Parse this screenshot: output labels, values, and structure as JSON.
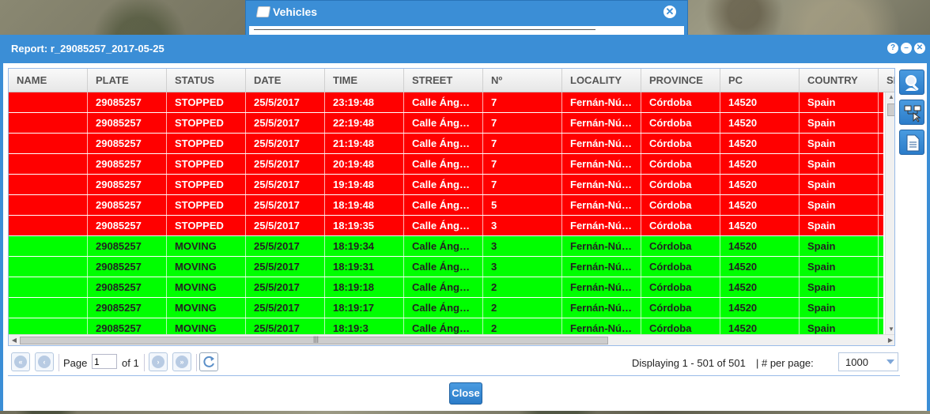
{
  "vehicles_window": {
    "title": "Vehicles"
  },
  "report_window": {
    "title": "Report: r_29085257_2017-05-25",
    "tools": [
      "help-icon",
      "minimize-icon",
      "close-icon"
    ]
  },
  "grid": {
    "columns": [
      {
        "key": "name",
        "label": "NAME"
      },
      {
        "key": "plate",
        "label": "PLATE"
      },
      {
        "key": "status",
        "label": "STATUS"
      },
      {
        "key": "date",
        "label": "DATE"
      },
      {
        "key": "time",
        "label": "TIME"
      },
      {
        "key": "street",
        "label": "STREET"
      },
      {
        "key": "number",
        "label": "Nº"
      },
      {
        "key": "locality",
        "label": "LOCALITY"
      },
      {
        "key": "province",
        "label": "PROVINCE"
      },
      {
        "key": "pc",
        "label": "PC"
      },
      {
        "key": "country",
        "label": "COUNTRY"
      },
      {
        "key": "sp",
        "label": "SP"
      }
    ],
    "rows": [
      {
        "name": "",
        "plate": "29085257",
        "status": "STOPPED",
        "date": "25/5/2017",
        "time": "23:19:48",
        "street": "Calle Áng…",
        "number": "7",
        "locality": "Fernán-Nú…",
        "province": "Córdoba",
        "pc": "14520",
        "country": "Spain",
        "sp": ""
      },
      {
        "name": "",
        "plate": "29085257",
        "status": "STOPPED",
        "date": "25/5/2017",
        "time": "22:19:48",
        "street": "Calle Áng…",
        "number": "7",
        "locality": "Fernán-Nú…",
        "province": "Córdoba",
        "pc": "14520",
        "country": "Spain",
        "sp": ""
      },
      {
        "name": "",
        "plate": "29085257",
        "status": "STOPPED",
        "date": "25/5/2017",
        "time": "21:19:48",
        "street": "Calle Áng…",
        "number": "7",
        "locality": "Fernán-Nú…",
        "province": "Córdoba",
        "pc": "14520",
        "country": "Spain",
        "sp": ""
      },
      {
        "name": "",
        "plate": "29085257",
        "status": "STOPPED",
        "date": "25/5/2017",
        "time": "20:19:48",
        "street": "Calle Áng…",
        "number": "7",
        "locality": "Fernán-Nú…",
        "province": "Córdoba",
        "pc": "14520",
        "country": "Spain",
        "sp": ""
      },
      {
        "name": "",
        "plate": "29085257",
        "status": "STOPPED",
        "date": "25/5/2017",
        "time": "19:19:48",
        "street": "Calle Áng…",
        "number": "7",
        "locality": "Fernán-Nú…",
        "province": "Córdoba",
        "pc": "14520",
        "country": "Spain",
        "sp": ""
      },
      {
        "name": "",
        "plate": "29085257",
        "status": "STOPPED",
        "date": "25/5/2017",
        "time": "18:19:48",
        "street": "Calle Áng…",
        "number": "5",
        "locality": "Fernán-Nú…",
        "province": "Córdoba",
        "pc": "14520",
        "country": "Spain",
        "sp": ""
      },
      {
        "name": "",
        "plate": "29085257",
        "status": "STOPPED",
        "date": "25/5/2017",
        "time": "18:19:35",
        "street": "Calle Áng…",
        "number": "3",
        "locality": "Fernán-Nú…",
        "province": "Córdoba",
        "pc": "14520",
        "country": "Spain",
        "sp": ""
      },
      {
        "name": "",
        "plate": "29085257",
        "status": "MOVING",
        "date": "25/5/2017",
        "time": "18:19:34",
        "street": "Calle Áng…",
        "number": "3",
        "locality": "Fernán-Nú…",
        "province": "Córdoba",
        "pc": "14520",
        "country": "Spain",
        "sp": ""
      },
      {
        "name": "",
        "plate": "29085257",
        "status": "MOVING",
        "date": "25/5/2017",
        "time": "18:19:31",
        "street": "Calle Áng…",
        "number": "3",
        "locality": "Fernán-Nú…",
        "province": "Córdoba",
        "pc": "14520",
        "country": "Spain",
        "sp": ""
      },
      {
        "name": "",
        "plate": "29085257",
        "status": "MOVING",
        "date": "25/5/2017",
        "time": "18:19:18",
        "street": "Calle Áng…",
        "number": "2",
        "locality": "Fernán-Nú…",
        "province": "Córdoba",
        "pc": "14520",
        "country": "Spain",
        "sp": ""
      },
      {
        "name": "",
        "plate": "29085257",
        "status": "MOVING",
        "date": "25/5/2017",
        "time": "18:19:17",
        "street": "Calle Áng…",
        "number": "2",
        "locality": "Fernán-Nú…",
        "province": "Córdoba",
        "pc": "14520",
        "country": "Spain",
        "sp": ""
      },
      {
        "name": "",
        "plate": "29085257",
        "status": "MOVING",
        "date": "25/5/2017",
        "time": "18:19:3",
        "street": "Calle Áng…",
        "number": "2",
        "locality": "Fernán-Nú…",
        "province": "Córdoba",
        "pc": "14520",
        "country": "Spain",
        "sp": ""
      }
    ],
    "status_colors": {
      "STOPPED": "#ff0000",
      "MOVING": "#00ff00"
    }
  },
  "side_toolbar": [
    "search-vehicle-icon",
    "network-select-icon",
    "document-report-icon"
  ],
  "pager": {
    "page_label": "Page",
    "page_value": "1",
    "of_label": "of 1",
    "display_text": "Displaying 1 - 501 of 501",
    "per_page_label": "| # per page:",
    "per_page_value": "1000"
  },
  "footer": {
    "close_label": "Close"
  },
  "colors": {
    "window_blue": "#3b8ed6",
    "grid_border": "#99bbe8"
  }
}
